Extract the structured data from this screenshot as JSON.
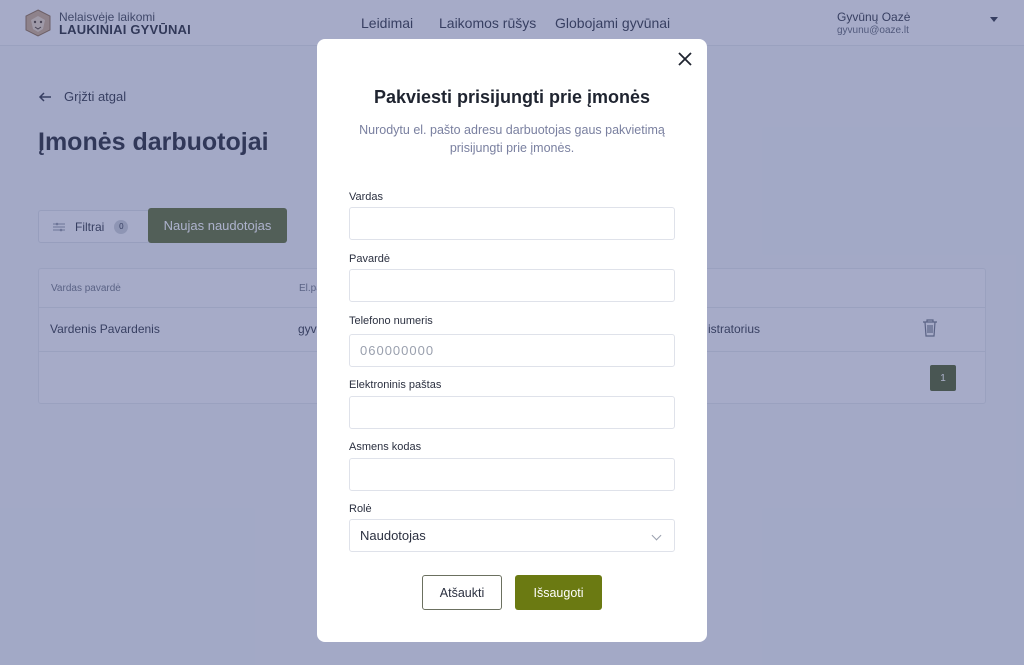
{
  "header": {
    "brand_top": "Nelaisvėje laikomi",
    "brand_bottom": "LAUKINIAI GYVŪNAI",
    "nav": [
      "Leidimai",
      "Laikomos rūšys",
      "Globojami gyvūnai"
    ],
    "user_name": "Gyvūnų Oazė",
    "user_email": "gyvunu@oaze.lt"
  },
  "page": {
    "back_label": "Grįžti atgal",
    "title": "Įmonės darbuotojai",
    "filter_label": "Filtrai",
    "filter_count": "0",
    "new_user_label": "Naujas naudotojas",
    "table": {
      "columns": [
        "Vardas pavardė",
        "El.pa"
      ],
      "row": {
        "name": "Vardenis Pavardenis",
        "email": "gyvu",
        "role": "istratorius"
      },
      "page": "1"
    }
  },
  "modal": {
    "title": "Pakviesti prisijungti prie įmonės",
    "subtitle": "Nurodytu el. pašto adresu darbuotojas gaus pakvietimą prisijungti prie įmonės.",
    "fields": {
      "first_name": {
        "label": "Vardas",
        "value": "",
        "placeholder": ""
      },
      "last_name": {
        "label": "Pavardė",
        "value": "",
        "placeholder": ""
      },
      "phone": {
        "label": "Telefono numeris",
        "value": "",
        "placeholder": "060000000"
      },
      "email": {
        "label": "Elektroninis paštas",
        "value": "",
        "placeholder": ""
      },
      "personal_code": {
        "label": "Asmens kodas",
        "value": "",
        "placeholder": ""
      },
      "role": {
        "label": "Rolė",
        "value": "Naudotojas"
      }
    },
    "cancel_label": "Atšaukti",
    "save_label": "Išsaugoti"
  },
  "colors": {
    "primary_button": "#6b7a12",
    "overlay": "#46528c",
    "new_user_button": "#5c6b2f"
  }
}
